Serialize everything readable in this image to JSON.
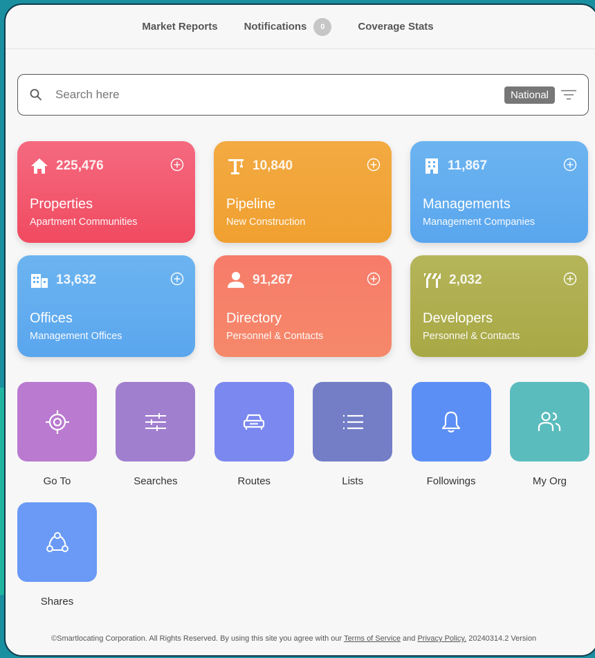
{
  "nav": {
    "market_reports": "Market Reports",
    "notifications": "Notifications",
    "notifications_count": "0",
    "coverage_stats": "Coverage Stats"
  },
  "search": {
    "placeholder": "Search here",
    "scope": "National"
  },
  "cards": [
    {
      "count": "225,476",
      "title": "Properties",
      "subtitle": "Apartment Communities",
      "icon": "house-icon",
      "color": "#f2566c"
    },
    {
      "count": "10,840",
      "title": "Pipeline",
      "subtitle": "New Construction",
      "icon": "crane-icon",
      "color": "#f1a536"
    },
    {
      "count": "11,867",
      "title": "Managements",
      "subtitle": "Management Companies",
      "icon": "building-icon",
      "color": "#62aef0"
    },
    {
      "count": "13,632",
      "title": "Offices",
      "subtitle": "Management Offices",
      "icon": "office-buildings-icon",
      "color": "#62aef0"
    },
    {
      "count": "91,267",
      "title": "Directory",
      "subtitle": "Personnel & Contacts",
      "icon": "person-icon",
      "color": "#f6826a"
    },
    {
      "count": "2,032",
      "title": "Developers",
      "subtitle": "Personnel & Contacts",
      "icon": "barrier-icon",
      "color": "#aead4e"
    }
  ],
  "tiles": [
    {
      "label": "Go To",
      "icon": "target-icon",
      "color": "#b97ad0"
    },
    {
      "label": "Searches",
      "icon": "sliders-icon",
      "color": "#a17fcf"
    },
    {
      "label": "Routes",
      "icon": "car-icon",
      "color": "#7b88ef"
    },
    {
      "label": "Lists",
      "icon": "list-icon",
      "color": "#737ec6"
    },
    {
      "label": "Followings",
      "icon": "bell-icon",
      "color": "#5b8ff5"
    },
    {
      "label": "My Org",
      "icon": "people-icon",
      "color": "#5bbcbd"
    },
    {
      "label": "Shares",
      "icon": "share-icon",
      "color": "#6a9af5"
    }
  ],
  "footer": {
    "prefix": "©Smartlocating Corporation. All Rights Reserved. By using this site you agree with our ",
    "terms": "Terms of Service",
    "and": " and ",
    "privacy": "Privacy Policy.",
    "version": " 20240314.2 Version"
  }
}
